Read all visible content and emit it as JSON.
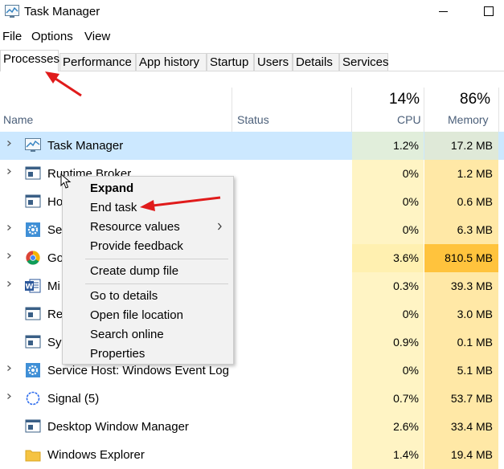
{
  "window": {
    "title": "Task Manager",
    "app_icon": "task-manager-icon"
  },
  "menu": {
    "items": [
      "File",
      "Options",
      "View"
    ]
  },
  "tabs": [
    "Processes",
    "Performance",
    "App history",
    "Startup",
    "Users",
    "Details",
    "Services"
  ],
  "active_tab": "Processes",
  "columns": {
    "name": "Name",
    "status": "Status",
    "cpu": {
      "percent": "14%",
      "label": "CPU"
    },
    "memory": {
      "percent": "86%",
      "label": "Memory"
    }
  },
  "rows": [
    {
      "name": "Task Manager",
      "cpu": "1.2%",
      "memory": "17.2 MB",
      "icon": "task-manager-icon",
      "expandable": true,
      "selected": true
    },
    {
      "name": "Runtime Broker",
      "cpu": "0%",
      "memory": "1.2 MB",
      "icon": "window-app-icon",
      "expandable": true
    },
    {
      "name": "Ho",
      "cpu": "0%",
      "memory": "0.6 MB",
      "icon": "window-app-icon",
      "expandable": false
    },
    {
      "name": "Se",
      "cpu": "0%",
      "memory": "6.3 MB",
      "icon": "gear-icon",
      "expandable": true
    },
    {
      "name": "Go",
      "cpu": "3.6%",
      "memory": "810.5 MB",
      "icon": "chrome-icon",
      "expandable": true,
      "memory_highlight": true
    },
    {
      "name": "Mi",
      "cpu": "0.3%",
      "memory": "39.3 MB",
      "icon": "word-icon",
      "expandable": true
    },
    {
      "name": "Re",
      "cpu": "0%",
      "memory": "3.0 MB",
      "icon": "window-app-icon",
      "expandable": false
    },
    {
      "name": "Sy",
      "cpu": "0.9%",
      "memory": "0.1 MB",
      "icon": "window-app-icon",
      "expandable": false
    },
    {
      "name": "Service Host: Windows Event Log",
      "cpu": "0%",
      "memory": "5.1 MB",
      "icon": "gear-icon",
      "expandable": true
    },
    {
      "name": "Signal (5)",
      "cpu": "0.7%",
      "memory": "53.7 MB",
      "icon": "signal-icon",
      "expandable": true
    },
    {
      "name": "Desktop Window Manager",
      "cpu": "2.6%",
      "memory": "33.4 MB",
      "icon": "window-app-icon",
      "expandable": false
    },
    {
      "name": "Windows Explorer",
      "cpu": "1.4%",
      "memory": "19.4 MB",
      "icon": "folder-icon",
      "expandable": false
    }
  ],
  "context_menu": {
    "items": [
      {
        "label": "Expand",
        "bold": true
      },
      {
        "label": "End task"
      },
      {
        "label": "Resource values",
        "submenu": true
      },
      {
        "label": "Provide feedback"
      },
      {
        "label": "Create dump file"
      },
      {
        "label": "Go to details"
      },
      {
        "label": "Open file location"
      },
      {
        "label": "Search online"
      },
      {
        "label": "Properties"
      }
    ]
  },
  "colors": {
    "selected_row": "#cce8ff",
    "cpu_bg": "#fff4c4",
    "memory_bg": "#ffe8a6",
    "memory_hot": "#ffc33d",
    "annotation_arrow": "#e01b1b"
  }
}
